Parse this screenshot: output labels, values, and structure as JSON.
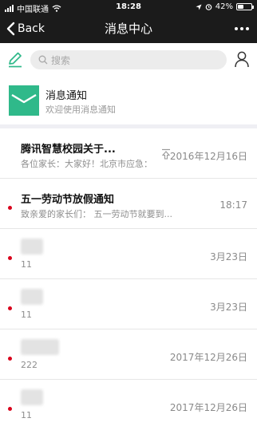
{
  "status_bar": {
    "carrier": "中国联通",
    "time": "18:28",
    "battery": "42%",
    "battery_level": 0.42
  },
  "nav": {
    "back_label": "Back",
    "title": "消息中心"
  },
  "search": {
    "placeholder": "搜索"
  },
  "notice": {
    "title": "消息通知",
    "subtitle": "欢迎使用消息通知"
  },
  "messages": [
    {
      "title": "腾讯智慧校园关于...",
      "preview": "各位家长：大家好！北京市应急：",
      "time": "2016年12月16日",
      "unread": false,
      "pinned": true,
      "blurred_title": false
    },
    {
      "title": "五一劳动节放假通知",
      "preview": "致亲爱的家长们：        五一劳动节就要到...",
      "time": "18:17",
      "unread": true,
      "pinned": false,
      "blurred_title": false
    },
    {
      "title": "",
      "preview": "11",
      "time": "3月23日",
      "unread": true,
      "pinned": false,
      "blurred_title": true
    },
    {
      "title": "",
      "preview": "11",
      "time": "3月23日",
      "unread": true,
      "pinned": false,
      "blurred_title": true
    },
    {
      "title": "",
      "preview": "222",
      "time": "2017年12月26日",
      "unread": true,
      "pinned": false,
      "blurred_title": true,
      "wide": true
    },
    {
      "title": "",
      "preview": "11",
      "time": "2017年12月26日",
      "unread": true,
      "pinned": false,
      "blurred_title": true
    }
  ],
  "icons": {
    "compose": "pencil-icon",
    "search": "search-icon",
    "contacts": "person-icon",
    "notice": "envelope-icon",
    "more": "more-dots-icon",
    "back": "chevron-left-icon",
    "pin": "pin-to-top-icon"
  },
  "colors": {
    "bar_background": "#1b1b1b",
    "accent_green": "#2fb98a",
    "unread_dot": "#d9001b"
  }
}
